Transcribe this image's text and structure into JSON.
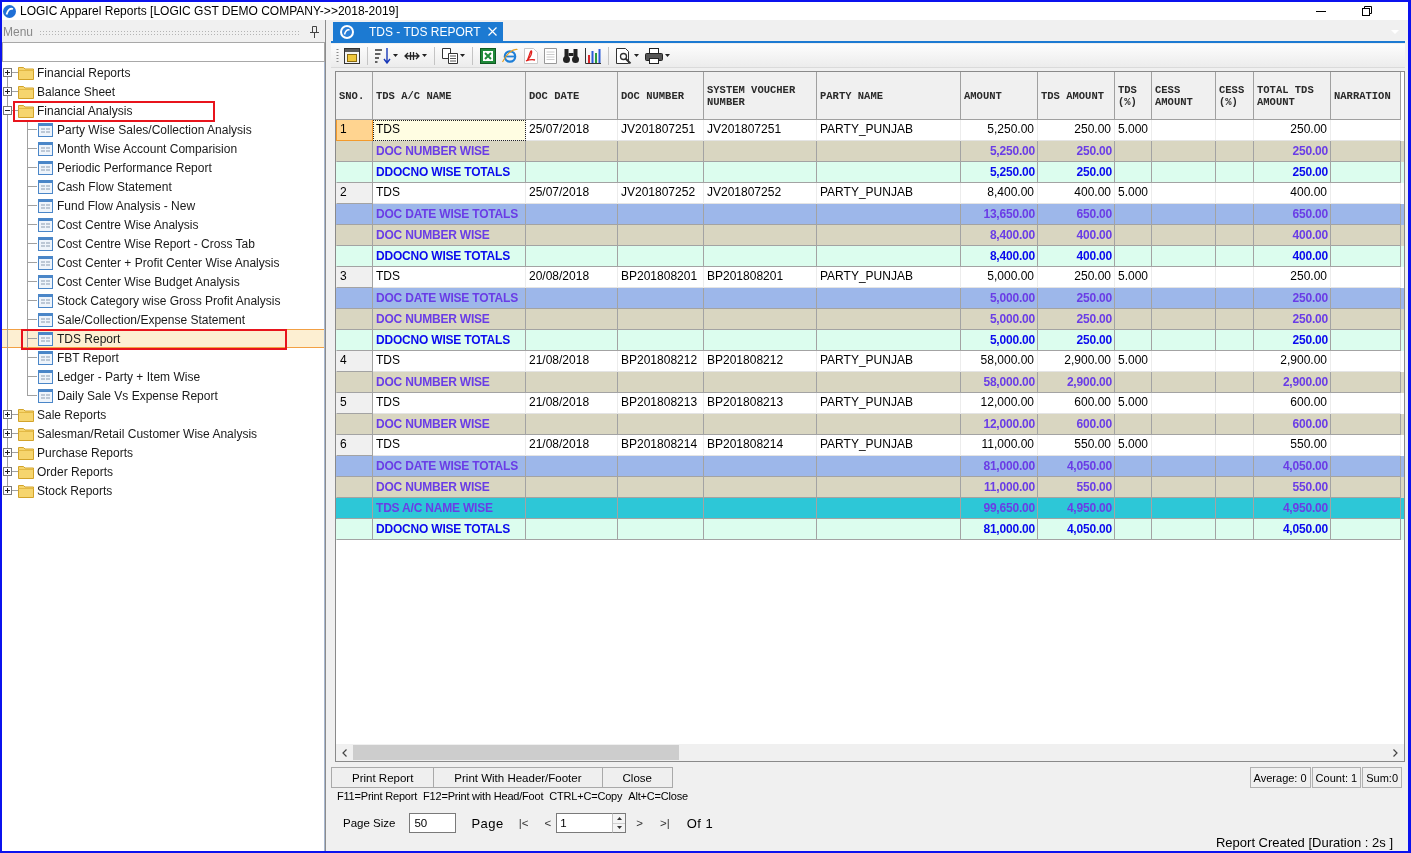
{
  "window": {
    "title": "LOGIC Apparel Reports [LOGIC GST DEMO COMPANY->>2018-2019]"
  },
  "menu": {
    "title": "Menu",
    "tree": [
      {
        "label": "Financial Reports",
        "expanded": false,
        "selected": false,
        "outlined": false
      },
      {
        "label": "Balance Sheet",
        "expanded": false,
        "selected": false,
        "outlined": false
      },
      {
        "label": "Financial Analysis",
        "expanded": true,
        "selected": false,
        "outlined": true,
        "children": [
          {
            "label": "Party Wise Sales/Collection Analysis",
            "selected": false,
            "outlined": false
          },
          {
            "label": "Month Wise Account Comparision",
            "selected": false,
            "outlined": false
          },
          {
            "label": "Periodic Performance Report",
            "selected": false,
            "outlined": false
          },
          {
            "label": "Cash Flow Statement",
            "selected": false,
            "outlined": false
          },
          {
            "label": "Fund Flow Analysis - New",
            "selected": false,
            "outlined": false
          },
          {
            "label": "Cost Centre Wise Analysis",
            "selected": false,
            "outlined": false
          },
          {
            "label": "Cost Centre Wise Report - Cross Tab",
            "selected": false,
            "outlined": false
          },
          {
            "label": "Cost Center + Profit Center Wise Analysis",
            "selected": false,
            "outlined": false
          },
          {
            "label": "Cost Center Wise Budget Analysis",
            "selected": false,
            "outlined": false
          },
          {
            "label": "Stock Category wise Gross Profit Analysis",
            "selected": false,
            "outlined": false
          },
          {
            "label": "Sale/Collection/Expense Statement",
            "selected": false,
            "outlined": false
          },
          {
            "label": "TDS Report",
            "selected": true,
            "outlined": true
          },
          {
            "label": "FBT Report",
            "selected": false,
            "outlined": false
          },
          {
            "label": "Ledger - Party + Item Wise",
            "selected": false,
            "outlined": false
          },
          {
            "label": "Daily Sale Vs Expense Report",
            "selected": false,
            "outlined": false
          }
        ]
      },
      {
        "label": "Sale Reports",
        "expanded": false,
        "selected": false,
        "outlined": false
      },
      {
        "label": "Salesman/Retail Customer Wise Analysis",
        "expanded": false,
        "selected": false,
        "outlined": false
      },
      {
        "label": "Purchase Reports",
        "expanded": false,
        "selected": false,
        "outlined": false
      },
      {
        "label": "Order Reports",
        "expanded": false,
        "selected": false,
        "outlined": false
      },
      {
        "label": "Stock Reports",
        "expanded": false,
        "selected": false,
        "outlined": false
      }
    ]
  },
  "tabs": [
    {
      "label": "TDS - TDS REPORT",
      "selected": true
    }
  ],
  "table": {
    "columns": [
      "SNO.",
      "TDS A/C NAME",
      "DOC DATE",
      "DOC NUMBER",
      "SYSTEM VOUCHER NUMBER",
      "PARTY NAME",
      "AMOUNT",
      "TDS AMOUNT",
      "TDS (%)",
      "CESS AMOUNT",
      "CESS (%)",
      "TOTAL TDS AMOUNT",
      "NARRATION"
    ],
    "rows": [
      {
        "kind": "data",
        "selected": true,
        "sno": "1",
        "tds_ac_name": "TDS",
        "doc_date": "25/07/2018",
        "doc_number": "JV201807251",
        "system_voucher_number": "JV201807251",
        "party_name": "PARTY_PUNJAB",
        "amount": "5,250.00",
        "tds_amount": "250.00",
        "tds_pct": "5.000",
        "total_tds_amount": "250.00"
      },
      {
        "kind": "doc_number_wise",
        "selected": false,
        "label": "DOC NUMBER WISE",
        "amount": "5,250.00",
        "tds_amount": "250.00",
        "total_tds_amount": "250.00"
      },
      {
        "kind": "ddocno_wise",
        "selected": false,
        "label": "DDOCNO WISE TOTALS",
        "amount": "5,250.00",
        "tds_amount": "250.00",
        "total_tds_amount": "250.00"
      },
      {
        "kind": "data",
        "selected": false,
        "sno": "2",
        "tds_ac_name": "TDS",
        "doc_date": "25/07/2018",
        "doc_number": "JV201807252",
        "system_voucher_number": "JV201807252",
        "party_name": "PARTY_PUNJAB",
        "amount": "8,400.00",
        "tds_amount": "400.00",
        "tds_pct": "5.000",
        "total_tds_amount": "400.00"
      },
      {
        "kind": "doc_date_wise",
        "selected": false,
        "label": "DOC DATE WISE TOTALS",
        "amount": "13,650.00",
        "tds_amount": "650.00",
        "total_tds_amount": "650.00"
      },
      {
        "kind": "doc_number_wise",
        "selected": false,
        "label": "DOC NUMBER WISE",
        "amount": "8,400.00",
        "tds_amount": "400.00",
        "total_tds_amount": "400.00"
      },
      {
        "kind": "ddocno_wise",
        "selected": false,
        "label": "DDOCNO WISE TOTALS",
        "amount": "8,400.00",
        "tds_amount": "400.00",
        "total_tds_amount": "400.00"
      },
      {
        "kind": "data",
        "selected": false,
        "sno": "3",
        "tds_ac_name": "TDS",
        "doc_date": "20/08/2018",
        "doc_number": "BP201808201",
        "system_voucher_number": "BP201808201",
        "party_name": "PARTY_PUNJAB",
        "amount": "5,000.00",
        "tds_amount": "250.00",
        "tds_pct": "5.000",
        "total_tds_amount": "250.00"
      },
      {
        "kind": "doc_date_wise",
        "selected": false,
        "label": "DOC DATE WISE TOTALS",
        "amount": "5,000.00",
        "tds_amount": "250.00",
        "total_tds_amount": "250.00"
      },
      {
        "kind": "doc_number_wise",
        "selected": false,
        "label": "DOC NUMBER WISE",
        "amount": "5,000.00",
        "tds_amount": "250.00",
        "total_tds_amount": "250.00"
      },
      {
        "kind": "ddocno_wise",
        "selected": false,
        "label": "DDOCNO WISE TOTALS",
        "amount": "5,000.00",
        "tds_amount": "250.00",
        "total_tds_amount": "250.00"
      },
      {
        "kind": "data",
        "selected": false,
        "sno": "4",
        "tds_ac_name": "TDS",
        "doc_date": "21/08/2018",
        "doc_number": "BP201808212",
        "system_voucher_number": "BP201808212",
        "party_name": "PARTY_PUNJAB",
        "amount": "58,000.00",
        "tds_amount": "2,900.00",
        "tds_pct": "5.000",
        "total_tds_amount": "2,900.00"
      },
      {
        "kind": "doc_number_wise",
        "selected": false,
        "label": "DOC NUMBER WISE",
        "amount": "58,000.00",
        "tds_amount": "2,900.00",
        "total_tds_amount": "2,900.00"
      },
      {
        "kind": "data",
        "selected": false,
        "sno": "5",
        "tds_ac_name": "TDS",
        "doc_date": "21/08/2018",
        "doc_number": "BP201808213",
        "system_voucher_number": "BP201808213",
        "party_name": "PARTY_PUNJAB",
        "amount": "12,000.00",
        "tds_amount": "600.00",
        "tds_pct": "5.000",
        "total_tds_amount": "600.00"
      },
      {
        "kind": "doc_number_wise",
        "selected": false,
        "label": "DOC NUMBER WISE",
        "amount": "12,000.00",
        "tds_amount": "600.00",
        "total_tds_amount": "600.00"
      },
      {
        "kind": "data",
        "selected": false,
        "sno": "6",
        "tds_ac_name": "TDS",
        "doc_date": "21/08/2018",
        "doc_number": "BP201808214",
        "system_voucher_number": "BP201808214",
        "party_name": "PARTY_PUNJAB",
        "amount": "11,000.00",
        "tds_amount": "550.00",
        "tds_pct": "5.000",
        "total_tds_amount": "550.00"
      },
      {
        "kind": "doc_date_wise",
        "selected": false,
        "label": "DOC DATE WISE TOTALS",
        "amount": "81,000.00",
        "tds_amount": "4,050.00",
        "total_tds_amount": "4,050.00"
      },
      {
        "kind": "doc_number_wise",
        "selected": false,
        "label": "DOC NUMBER WISE",
        "amount": "11,000.00",
        "tds_amount": "550.00",
        "total_tds_amount": "550.00"
      },
      {
        "kind": "ac_name_wise",
        "selected": false,
        "label": "TDS A/C NAME WISE",
        "amount": "99,650.00",
        "tds_amount": "4,950.00",
        "total_tds_amount": "4,950.00"
      },
      {
        "kind": "ddocno_wise",
        "selected": false,
        "label": "DDOCNO WISE TOTALS",
        "amount": "81,000.00",
        "tds_amount": "4,050.00",
        "total_tds_amount": "4,050.00"
      }
    ]
  },
  "buttons": [
    "Print Report",
    "Print With Header/Footer",
    "Close"
  ],
  "summary": [
    "Average: 0",
    "Count: 1",
    "Sum:0"
  ],
  "shortcuts": [
    "F11=Print Report",
    "F12=Print with Head/Foot",
    "CTRL+C=Copy",
    "Alt+C=Close"
  ],
  "pager": {
    "page_size_label": "Page Size",
    "page_size": "50",
    "page_label": "Page",
    "first": "|<",
    "previous": "<",
    "page": "1",
    "next": ">",
    "last": ">|",
    "page_count": "Of 1"
  },
  "status": "Report Created [Duration : 2s ]"
}
